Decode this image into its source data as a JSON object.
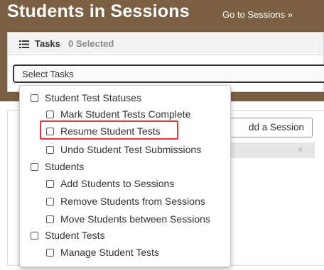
{
  "header": {
    "title": "Students in Sessions",
    "goto_link": "Go to Sessions »"
  },
  "tasks": {
    "label": "Tasks",
    "selected_count": "0 Selected",
    "select_placeholder": "Select Tasks"
  },
  "sessions": {
    "add_button": "dd a Session",
    "close_glyph": "×"
  },
  "dropdown": {
    "groups": [
      {
        "label": "Student Test Statuses",
        "items": [
          "Mark Student Tests Complete",
          "Resume Student Tests",
          "Undo Student Test Submissions"
        ]
      },
      {
        "label": "Students",
        "items": [
          "Add Students to Sessions",
          "Remove Students from Sessions",
          "Move Students between Sessions"
        ]
      },
      {
        "label": "Student Tests",
        "items": [
          "Manage Student Tests"
        ]
      }
    ]
  },
  "colors": {
    "header_brown": "#7b5f42",
    "highlight_red": "#d9383a"
  },
  "icons": {
    "tasks": "list-icon",
    "checkbox": "checkbox-icon",
    "close": "close-icon"
  }
}
